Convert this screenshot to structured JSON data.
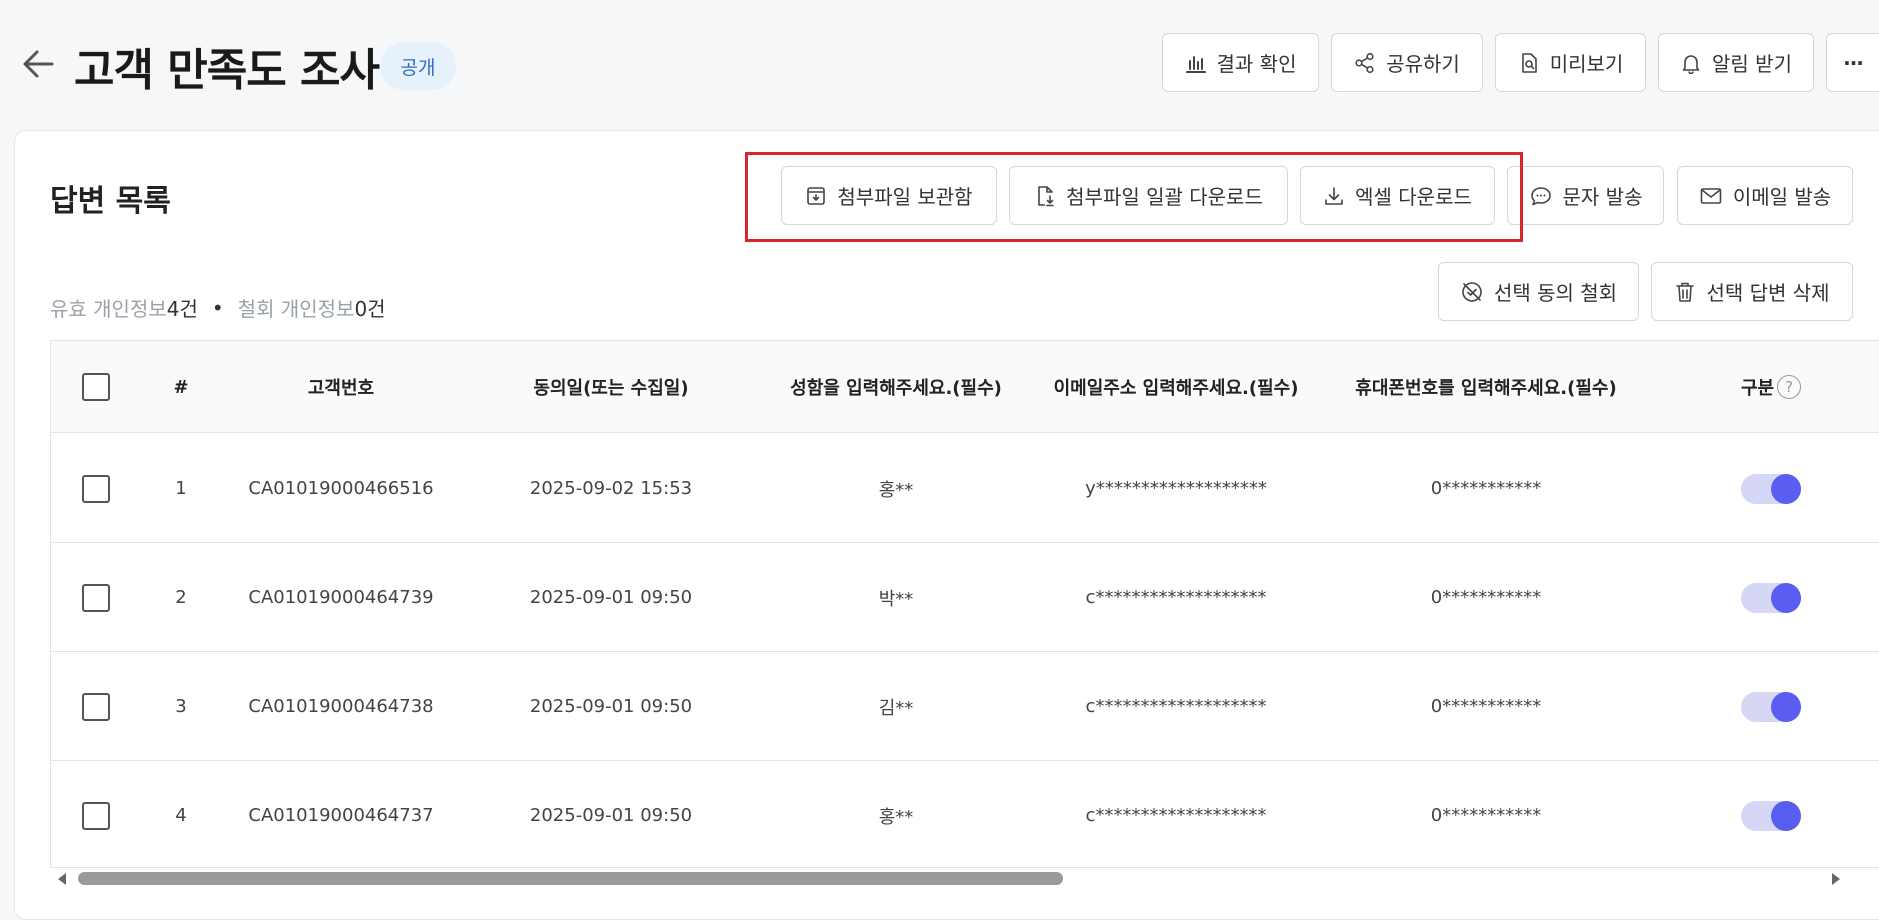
{
  "header": {
    "title": "고객 만족도 조사",
    "visibility_badge": "공개",
    "buttons": {
      "results": "결과 확인",
      "share": "공유하기",
      "preview": "미리보기",
      "notify": "알림 받기",
      "more": "···"
    }
  },
  "responses": {
    "section_title": "답변 목록",
    "actions": {
      "attachment_box": "첨부파일 보관함",
      "bulk_download": "첨부파일 일괄 다운로드",
      "excel_download": "엑셀 다운로드",
      "send_sms": "문자 발송",
      "send_email": "이메일 발송",
      "withdraw_consent": "선택 동의 철회",
      "delete_selected": "선택 답변 삭제"
    },
    "summary": {
      "valid_label": "유효 개인정보",
      "valid_count": "4건",
      "separator": "•",
      "withdrawn_label": "철회 개인정보",
      "withdrawn_count": "0건"
    },
    "columns": {
      "index": "#",
      "customer_no": "고객번호",
      "consent_date": "동의일(또는 수집일)",
      "name": "성함을 입력해주세요.(필수)",
      "email": "이메일주소 입력해주세요.(필수)",
      "phone": "휴대폰번호를 입력해주세요.(필수)",
      "category": "구분",
      "help": "?"
    },
    "rows": [
      {
        "index": "1",
        "customer_no": "CA01019000466516",
        "consent_date": "2025-09-02 15:53",
        "name": "홍**",
        "email": "y*******************",
        "phone": "0***********",
        "toggle_on": true
      },
      {
        "index": "2",
        "customer_no": "CA01019000464739",
        "consent_date": "2025-09-01 09:50",
        "name": "박**",
        "email": "c*******************",
        "phone": "0***********",
        "toggle_on": true
      },
      {
        "index": "3",
        "customer_no": "CA01019000464738",
        "consent_date": "2025-09-01 09:50",
        "name": "김**",
        "email": "c*******************",
        "phone": "0***********",
        "toggle_on": true
      },
      {
        "index": "4",
        "customer_no": "CA01019000464737",
        "consent_date": "2025-09-01 09:50",
        "name": "홍**",
        "email": "c*******************",
        "phone": "0***********",
        "toggle_on": true
      }
    ]
  },
  "colors": {
    "accent": "#5a5ef0",
    "highlight": "#d9262c",
    "badge_bg": "#e6f1fb",
    "badge_text": "#2f6fb8"
  }
}
